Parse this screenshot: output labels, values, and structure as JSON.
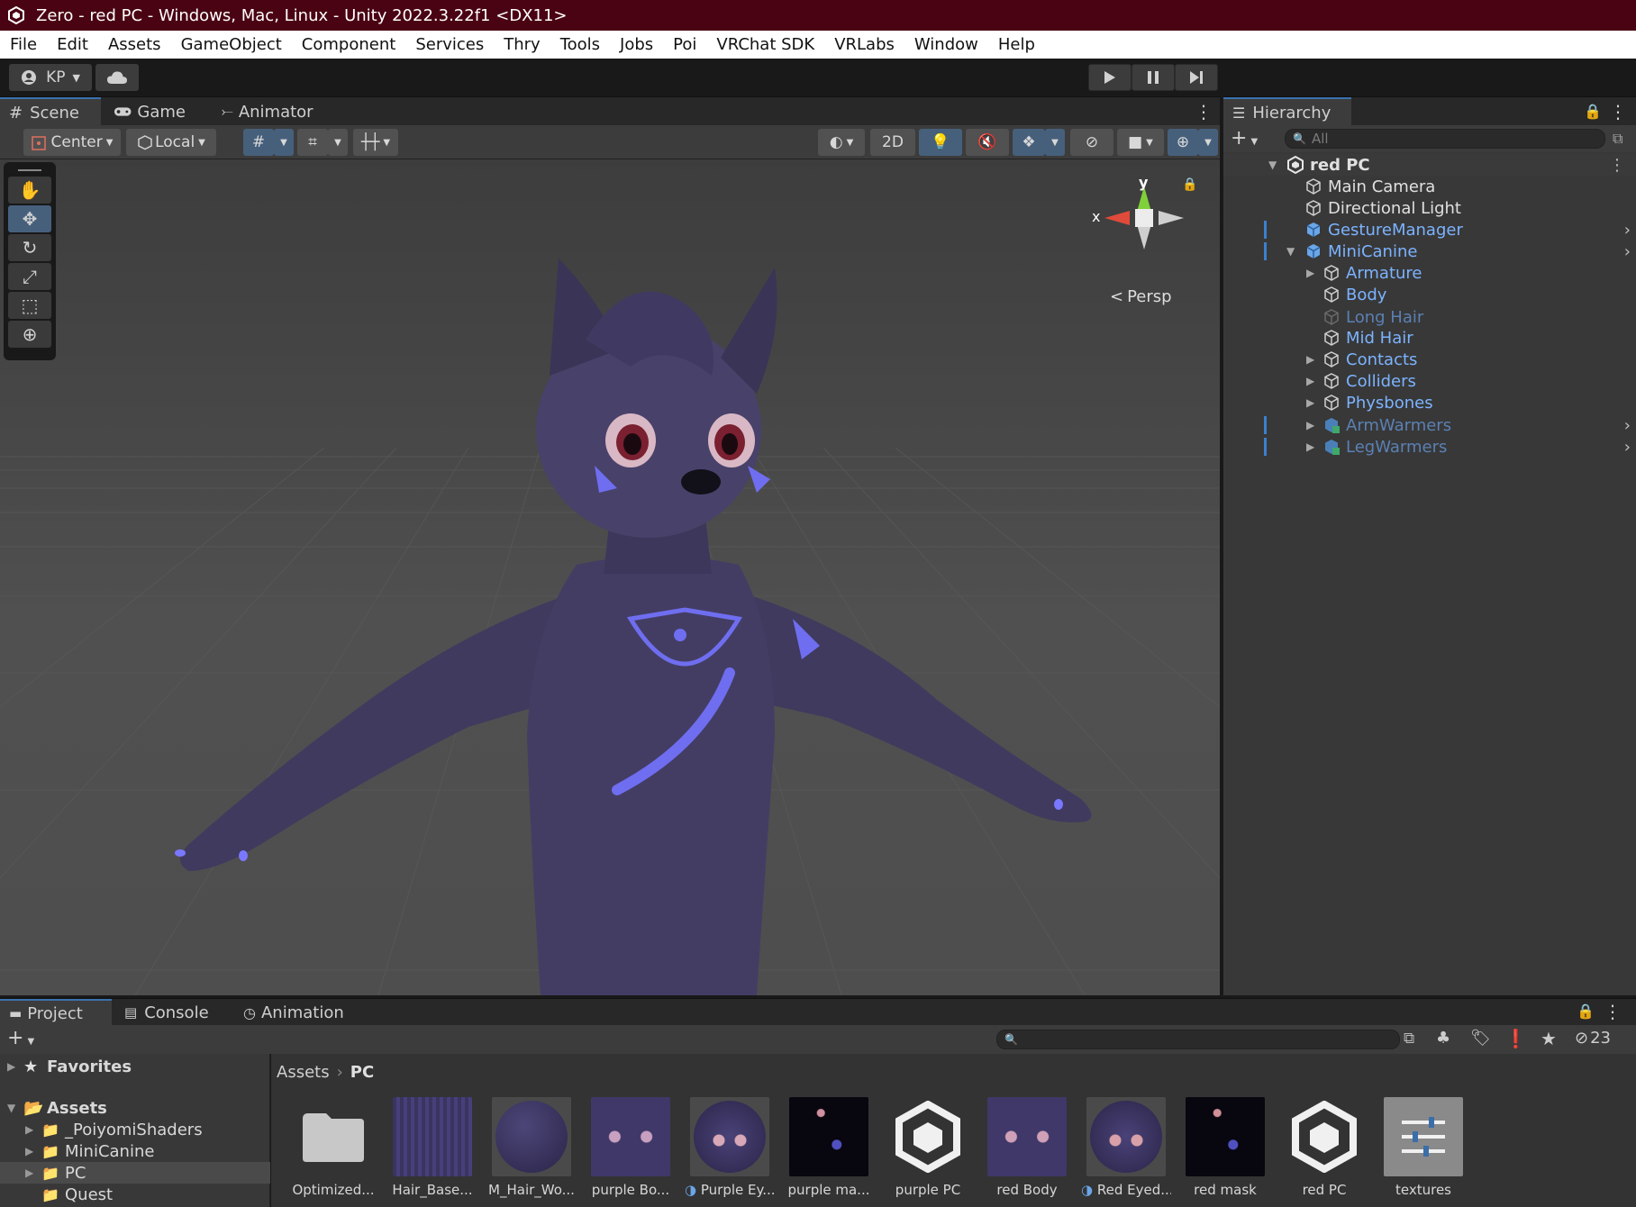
{
  "window": {
    "title": "Zero - red PC - Windows, Mac, Linux - Unity 2022.3.22f1 <DX11>"
  },
  "menu": [
    "File",
    "Edit",
    "Assets",
    "GameObject",
    "Component",
    "Services",
    "Thry",
    "Tools",
    "Jobs",
    "Poi",
    "VRChat SDK",
    "VRLabs",
    "Window",
    "Help"
  ],
  "toolbar": {
    "account": "KP"
  },
  "scene": {
    "tabs": [
      "Scene",
      "Game",
      "Animator"
    ],
    "pivot": "Center",
    "space": "Local",
    "mode_2d": "2D",
    "gizmo": {
      "y": "y",
      "x": "x",
      "persp": "Persp"
    }
  },
  "hierarchy": {
    "title": "Hierarchy",
    "search_placeholder": "All",
    "root": "red PC",
    "items": [
      {
        "label": "Main Camera"
      },
      {
        "label": "Directional Light"
      },
      {
        "label": "GestureManager"
      },
      {
        "label": "MiniCanine"
      },
      {
        "label": "Armature"
      },
      {
        "label": "Body"
      },
      {
        "label": "Long Hair"
      },
      {
        "label": "Mid Hair"
      },
      {
        "label": "Contacts"
      },
      {
        "label": "Colliders"
      },
      {
        "label": "Physbones"
      },
      {
        "label": "ArmWarmers"
      },
      {
        "label": "LegWarmers"
      }
    ]
  },
  "project": {
    "tabs": [
      "Project",
      "Console",
      "Animation"
    ],
    "hidden_count": "23",
    "breadcrumb": [
      "Assets",
      "PC"
    ],
    "tree": [
      {
        "label": "Favorites"
      },
      {
        "label": "Assets"
      },
      {
        "label": "_PoiyomiShaders"
      },
      {
        "label": "MiniCanine"
      },
      {
        "label": "PC"
      },
      {
        "label": "Quest"
      }
    ],
    "assets": [
      {
        "name": "Optimized..."
      },
      {
        "name": "Hair_Base..."
      },
      {
        "name": "M_Hair_Wo..."
      },
      {
        "name": "purple Bo..."
      },
      {
        "name": "Purple Ey..."
      },
      {
        "name": "purple ma..."
      },
      {
        "name": "purple PC"
      },
      {
        "name": "red Body"
      },
      {
        "name": "Red Eyed..."
      },
      {
        "name": "red mask"
      },
      {
        "name": "red PC"
      },
      {
        "name": "textures"
      }
    ]
  }
}
